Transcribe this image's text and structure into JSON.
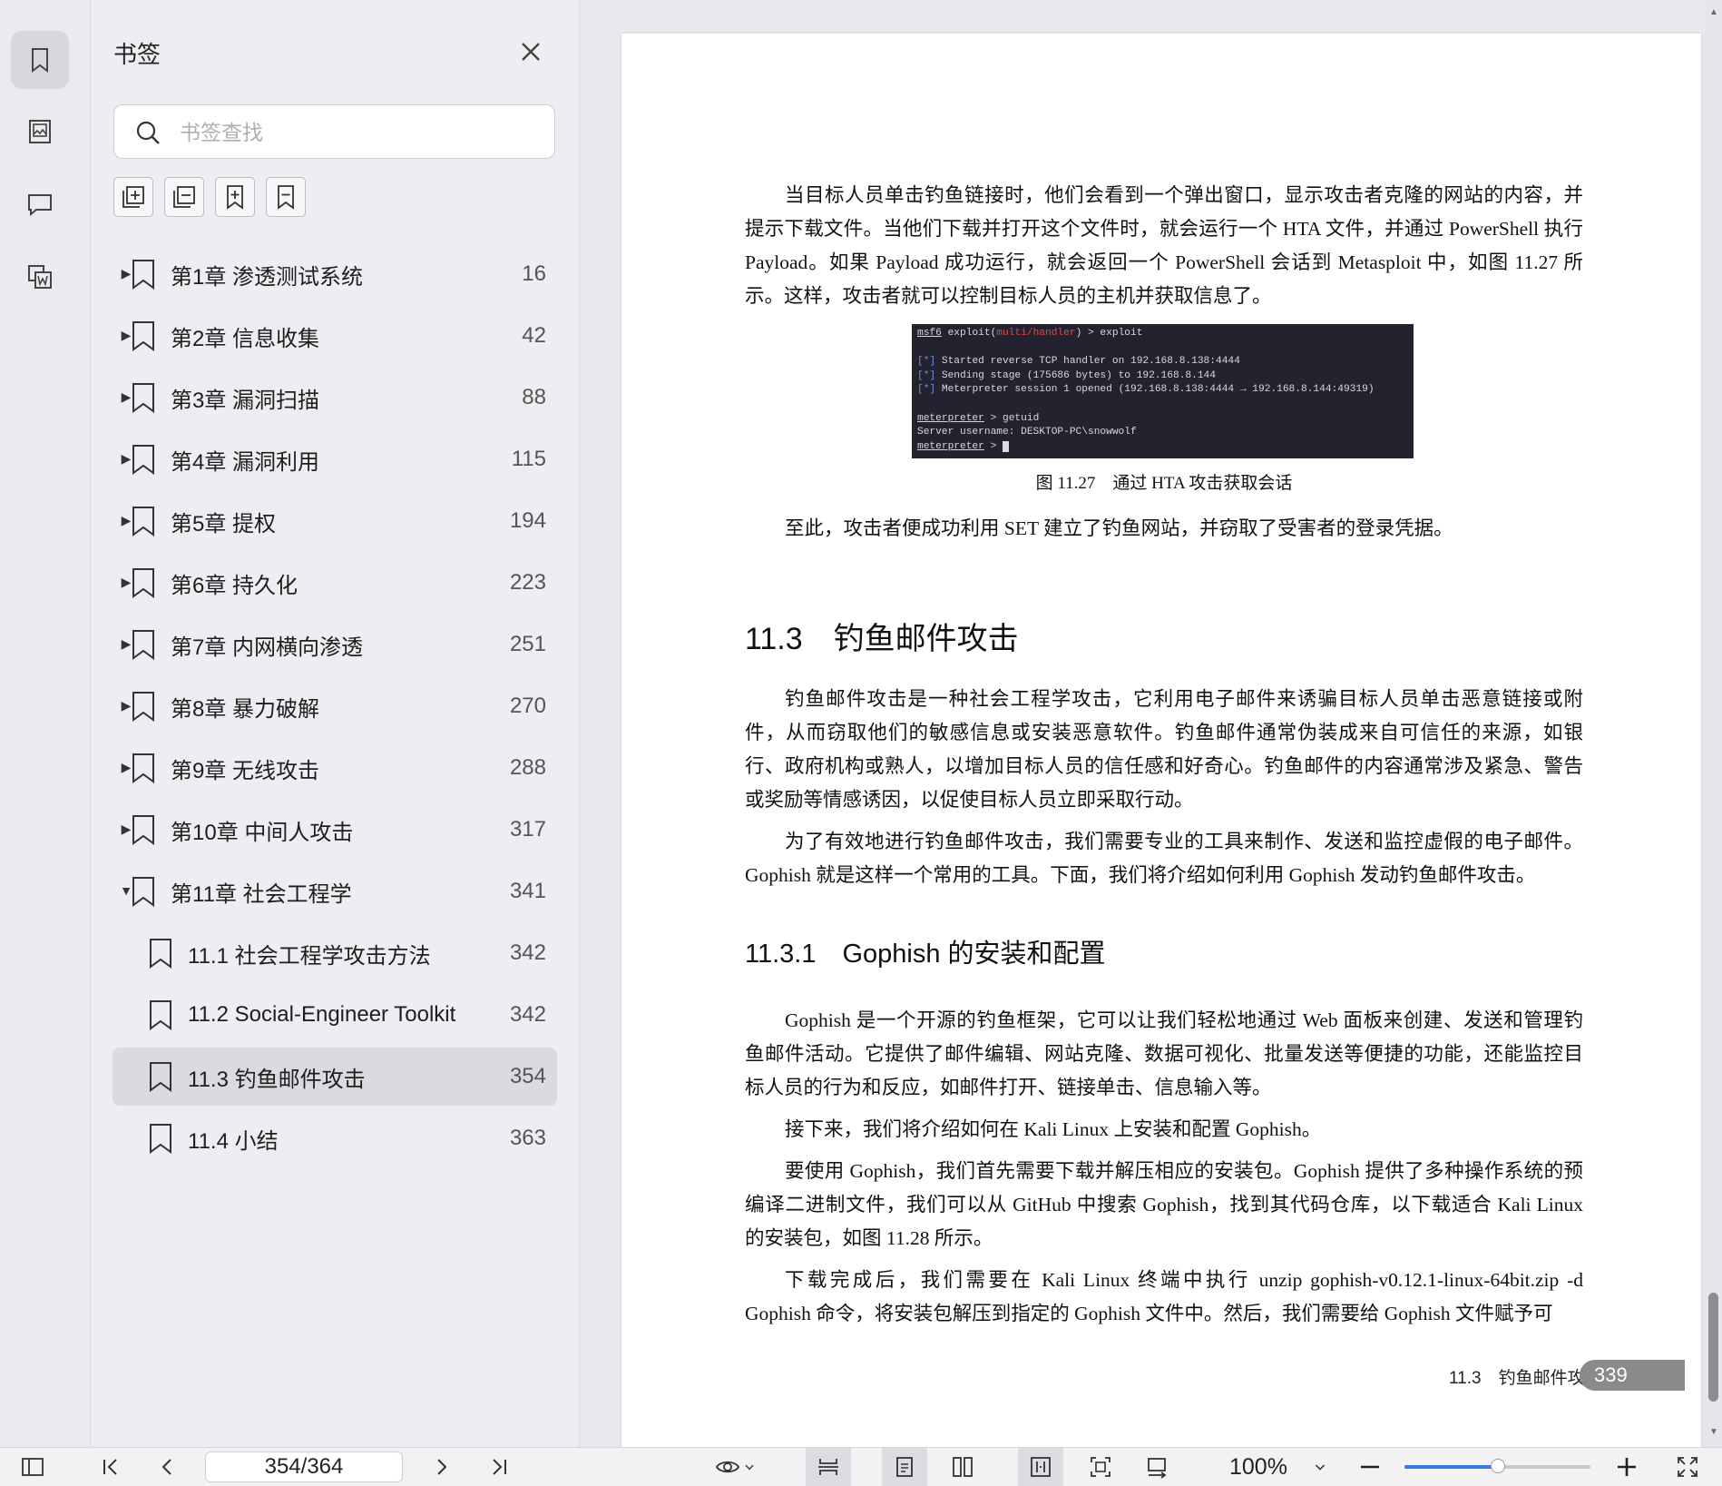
{
  "panel": {
    "title": "书签",
    "search_placeholder": "书签查找",
    "bookmarks": [
      {
        "label": "第1章 渗透测试系统",
        "page": "16",
        "level": 1,
        "expanded": false
      },
      {
        "label": "第2章 信息收集",
        "page": "42",
        "level": 1,
        "expanded": false
      },
      {
        "label": "第3章 漏洞扫描",
        "page": "88",
        "level": 1,
        "expanded": false
      },
      {
        "label": "第4章 漏洞利用",
        "page": "115",
        "level": 1,
        "expanded": false
      },
      {
        "label": "第5章 提权",
        "page": "194",
        "level": 1,
        "expanded": false
      },
      {
        "label": "第6章 持久化",
        "page": "223",
        "level": 1,
        "expanded": false
      },
      {
        "label": "第7章 内网横向渗透",
        "page": "251",
        "level": 1,
        "expanded": false
      },
      {
        "label": "第8章 暴力破解",
        "page": "270",
        "level": 1,
        "expanded": false
      },
      {
        "label": "第9章 无线攻击",
        "page": "288",
        "level": 1,
        "expanded": false
      },
      {
        "label": "第10章 中间人攻击",
        "page": "317",
        "level": 1,
        "expanded": false
      },
      {
        "label": "第11章 社会工程学",
        "page": "341",
        "level": 1,
        "expanded": true
      },
      {
        "label": "11.1 社会工程学攻击方法",
        "page": "342",
        "level": 2
      },
      {
        "label": "11.2 Social-Engineer Toolkit",
        "page": "342",
        "level": 2
      },
      {
        "label": "11.3 钓鱼邮件攻击",
        "page": "354",
        "level": 2,
        "selected": true
      },
      {
        "label": "11.4 小结",
        "page": "363",
        "level": 2
      }
    ]
  },
  "document": {
    "para1": "当目标人员单击钓鱼链接时，他们会看到一个弹出窗口，显示攻击者克隆的网站的内容，并提示下载文件。当他们下载并打开这个文件时，就会运行一个 HTA 文件，并通过 PowerShell 执行 Payload。如果 Payload 成功运行，就会返回一个 PowerShell 会话到 Metasploit 中，如图 11.27 所示。这样，攻击者就可以控制目标人员的主机并获取信息了。",
    "terminal": {
      "prompt_msf": "msf6",
      "cmd_exploit_pre": " exploit(",
      "module": "multi/handler",
      "cmd_exploit_post": ") > exploit",
      "tag": "[*]",
      "line1": " Started reverse TCP handler on 192.168.8.138:4444",
      "line2": " Sending stage (175686 bytes) to 192.168.8.144",
      "line3": " Meterpreter session 1 opened (192.168.8.138:4444 → 192.168.8.144:49319)",
      "prompt_met": "meterpreter",
      "cmd_getuid": " > getuid",
      "server_user": "Server username: DESKTOP-PC\\snowwolf",
      "cmd_last": " > "
    },
    "figure_caption": "图 11.27　通过 HTA 攻击获取会话",
    "para2": "至此，攻击者便成功利用 SET 建立了钓鱼网站，并窃取了受害者的登录凭据。",
    "heading_section": "11.3　钓鱼邮件攻击",
    "para3": "钓鱼邮件攻击是一种社会工程学攻击，它利用电子邮件来诱骗目标人员单击恶意链接或附件，从而窃取他们的敏感信息或安装恶意软件。钓鱼邮件通常伪装成来自可信任的来源，如银行、政府机构或熟人，以增加目标人员的信任感和好奇心。钓鱼邮件的内容通常涉及紧急、警告或奖励等情感诱因，以促使目标人员立即采取行动。",
    "para4": "为了有效地进行钓鱼邮件攻击，我们需要专业的工具来制作、发送和监控虚假的电子邮件。Gophish 就是这样一个常用的工具。下面，我们将介绍如何利用 Gophish 发动钓鱼邮件攻击。",
    "heading_subsection": "11.3.1　Gophish 的安装和配置",
    "para5": "Gophish 是一个开源的钓鱼框架，它可以让我们轻松地通过 Web 面板来创建、发送和管理钓鱼邮件活动。它提供了邮件编辑、网站克隆、数据可视化、批量发送等便捷的功能，还能监控目标人员的行为和反应，如邮件打开、链接单击、信息输入等。",
    "para6": "接下来，我们将介绍如何在 Kali Linux 上安装和配置 Gophish。",
    "para7": "要使用 Gophish，我们首先需要下载并解压相应的安装包。Gophish 提供了多种操作系统的预编译二进制文件，我们可以从 GitHub 中搜索 Gophish，找到其代码仓库，以下载适合 Kali Linux 的安装包，如图 11.28 所示。",
    "para8": "下载完成后，我们需要在 Kali Linux 终端中执行 unzip gophish-v0.12.1-linux-64bit.zip -d Gophish 命令，将安装包解压到指定的 Gophish 文件中。然后，我们需要给 Gophish 文件赋予可",
    "footer_section": "11.3　钓鱼邮件攻击",
    "footer_page": "339"
  },
  "toolbar": {
    "page_indicator": "354/364",
    "zoom": "100%",
    "zoom_level_fraction": 0.5
  }
}
